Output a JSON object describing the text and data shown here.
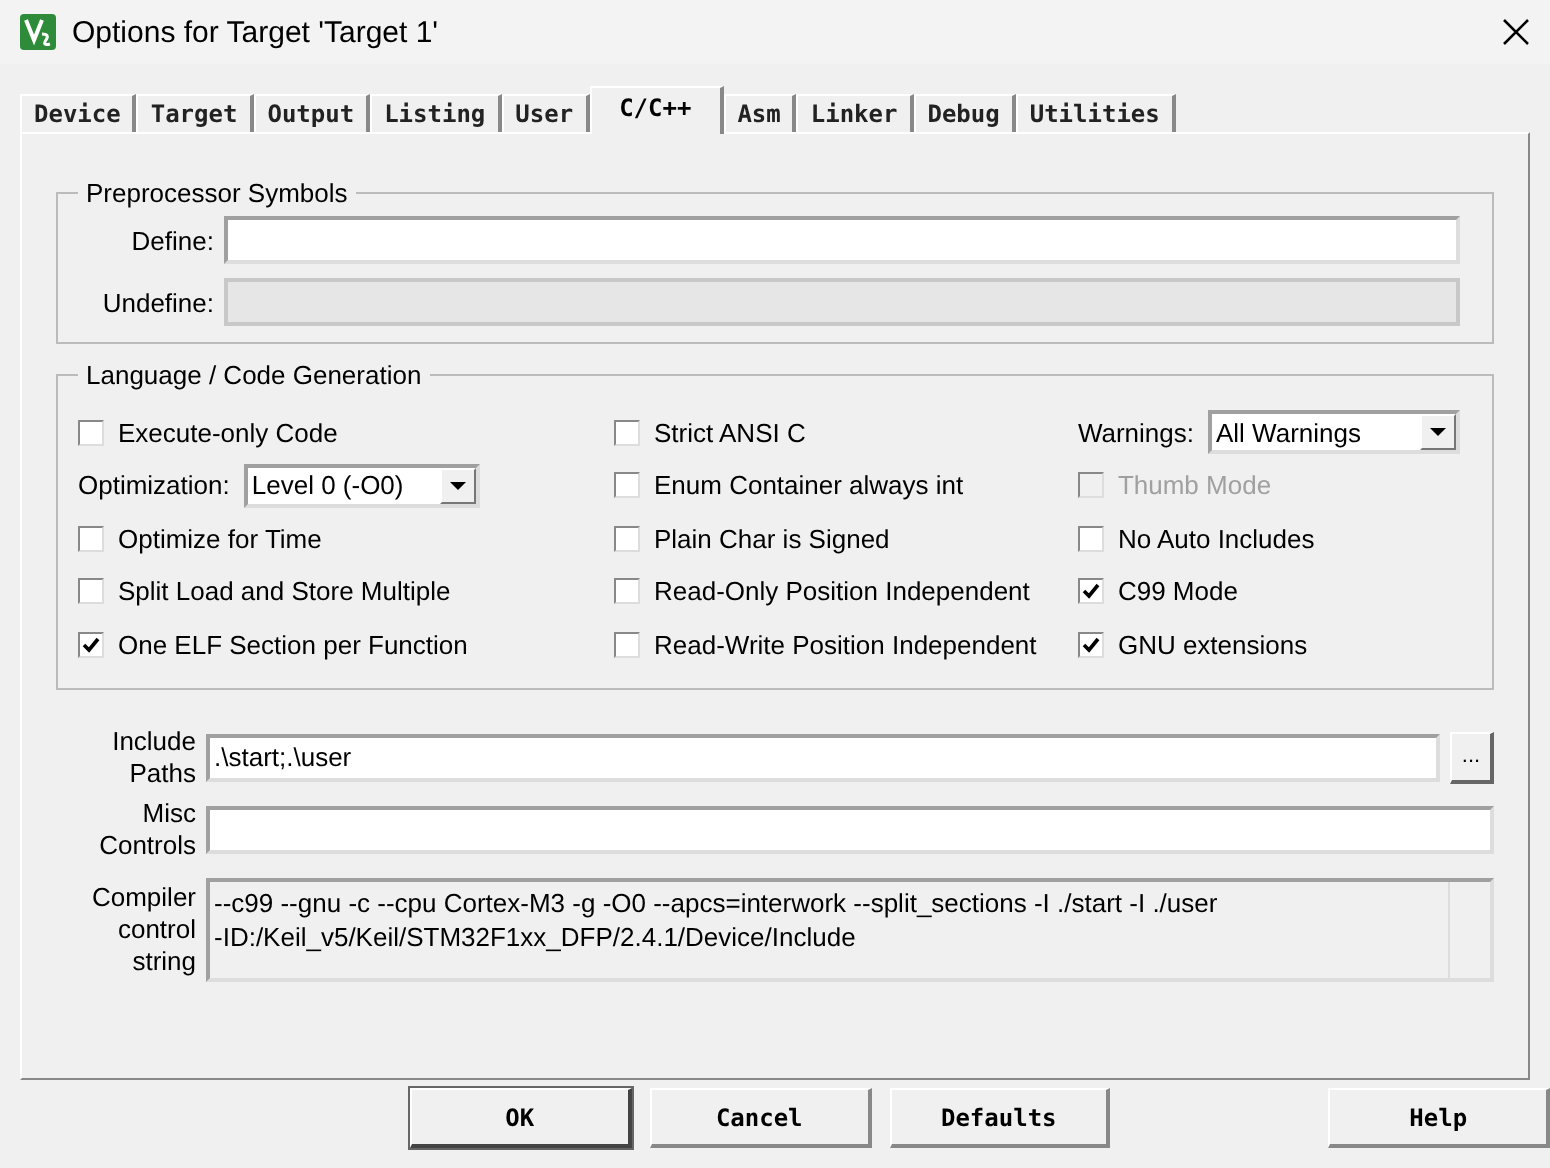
{
  "window": {
    "title": "Options for Target 'Target 1'"
  },
  "tabs": [
    {
      "label": "Device",
      "selected": false
    },
    {
      "label": "Target",
      "selected": false
    },
    {
      "label": "Output",
      "selected": false
    },
    {
      "label": "Listing",
      "selected": false
    },
    {
      "label": "User",
      "selected": false
    },
    {
      "label": "C/C++",
      "selected": true
    },
    {
      "label": "Asm",
      "selected": false
    },
    {
      "label": "Linker",
      "selected": false
    },
    {
      "label": "Debug",
      "selected": false
    },
    {
      "label": "Utilities",
      "selected": false
    }
  ],
  "preprocessor": {
    "title": "Preprocessor Symbols",
    "fields": [
      {
        "label": "Define:",
        "disabled": false
      },
      {
        "label": "Undefine:",
        "disabled": true
      }
    ]
  },
  "language": {
    "title": "Language / Code Generation",
    "columns": [
      [
        {
          "kind": "checkbox",
          "label": "Execute-only Code",
          "checked": false,
          "disabled": false
        },
        {
          "kind": "select",
          "label": "Optimization:",
          "value": "Level 0 (-O0)"
        },
        {
          "kind": "checkbox",
          "label": "Optimize for Time",
          "checked": false,
          "disabled": false
        },
        {
          "kind": "checkbox",
          "label": "Split Load and Store Multiple",
          "checked": false,
          "disabled": false
        },
        {
          "kind": "checkbox",
          "label": "One ELF Section per Function",
          "checked": true,
          "disabled": false
        }
      ],
      [
        {
          "kind": "checkbox",
          "label": "Strict ANSI C",
          "checked": false,
          "disabled": false
        },
        {
          "kind": "checkbox",
          "label": "Enum Container always int",
          "checked": false,
          "disabled": false
        },
        {
          "kind": "checkbox",
          "label": "Plain Char is Signed",
          "checked": false,
          "disabled": false
        },
        {
          "kind": "checkbox",
          "label": "Read-Only Position Independent",
          "checked": false,
          "disabled": false
        },
        {
          "kind": "checkbox",
          "label": "Read-Write Position Independent",
          "checked": false,
          "disabled": false
        }
      ],
      [
        {
          "kind": "select",
          "label": "Warnings:",
          "value": "All Warnings"
        },
        {
          "kind": "checkbox",
          "label": "Thumb Mode",
          "checked": false,
          "disabled": true
        },
        {
          "kind": "checkbox",
          "label": "No Auto Includes",
          "checked": false,
          "disabled": false
        },
        {
          "kind": "checkbox",
          "label": "C99 Mode",
          "checked": true,
          "disabled": false
        },
        {
          "kind": "checkbox",
          "label": "GNU extensions",
          "checked": true,
          "disabled": false
        }
      ]
    ]
  },
  "include_paths": {
    "label": [
      "Include",
      "Paths"
    ],
    "value": ".\\start;.\\user",
    "browse": "..."
  },
  "misc_controls": {
    "label": [
      "Misc",
      "Controls"
    ]
  },
  "compiler_string": {
    "label": [
      "Compiler",
      "control",
      "string"
    ],
    "lines": [
      "--c99 --gnu -c --cpu Cortex-M3 -g -O0 --apcs=interwork --split_sections -I ./start -I ./user",
      "-ID:/Keil_v5/Keil/STM32F1xx_DFP/2.4.1/Device/Include"
    ]
  },
  "buttons": [
    {
      "label": "OK",
      "default": true
    },
    {
      "label": "Cancel",
      "default": false
    },
    {
      "label": "Defaults",
      "default": false
    },
    {
      "label": "Help",
      "default": false
    }
  ]
}
